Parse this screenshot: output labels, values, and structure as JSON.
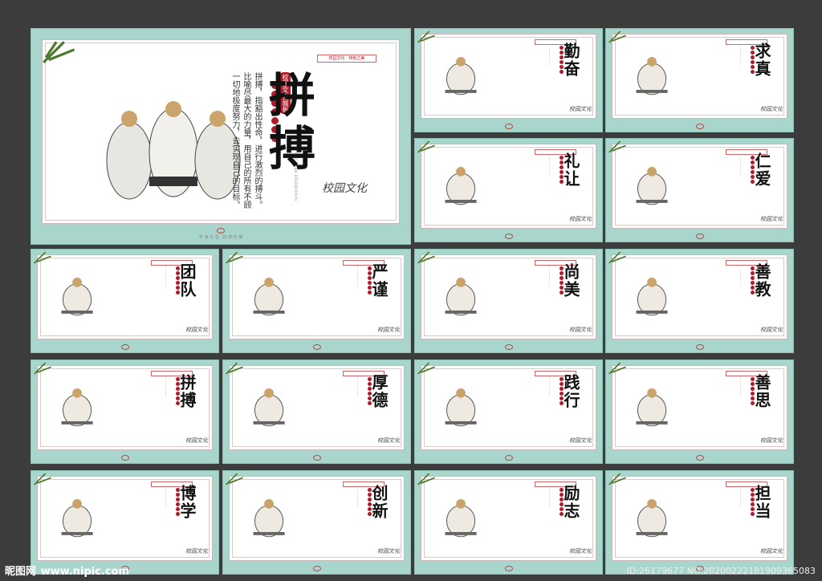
{
  "big": {
    "title": "拼搏",
    "label": "校园文化展板",
    "english": "CULTURE EXHIBITION",
    "seal": "校园文化 · 特色之美",
    "description": "拼搏，指豁出性命，进行激烈的搏斗。比喻尽最大的力量，用自己的所有不顾一切地极度努力，去实现自己的目标。",
    "signature": "校园文化",
    "footer": "学 海 无 涯 · 拼 搏 无 悔"
  },
  "panels": [
    {
      "title": "勤奋"
    },
    {
      "title": "求真"
    },
    {
      "title": "礼让"
    },
    {
      "title": "仁爱"
    },
    {
      "title": "团队"
    },
    {
      "title": "严谨"
    },
    {
      "title": "尚美"
    },
    {
      "title": "善教"
    },
    {
      "title": "拼搏"
    },
    {
      "title": "厚德"
    },
    {
      "title": "践行"
    },
    {
      "title": "善思"
    },
    {
      "title": "博学"
    },
    {
      "title": "创新"
    },
    {
      "title": "励志"
    },
    {
      "title": "担当"
    }
  ],
  "small_signature": "校园文化",
  "watermark": {
    "logo": "昵图网",
    "url": "www.nipic.com"
  },
  "image_id": "ID:26179677 NO:20200222181909365083",
  "colors": {
    "background": "#3c3c3c",
    "panel": "#a9d6cc",
    "accent": "#b11a2a"
  }
}
